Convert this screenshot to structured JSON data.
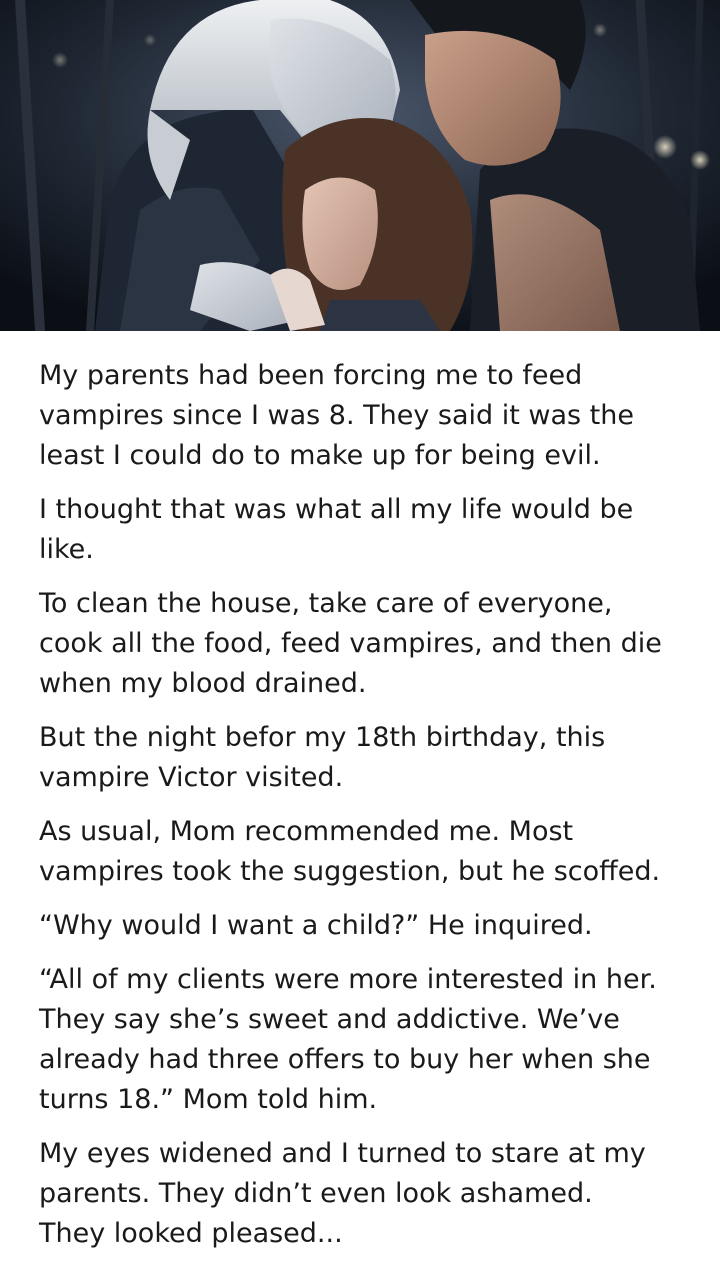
{
  "story": {
    "paragraphs": [
      [
        "My parents had been forcing me to feed",
        "vampires since I was 8. They said it was the",
        "least I could do to make up for being evil."
      ],
      [
        "I thought that was what all my life would be",
        "like."
      ],
      [
        "To clean the house, take care of everyone,",
        "cook all the food, feed vampires, and then die",
        "when my blood drained."
      ],
      [
        "But the night befor my 18th birthday, this",
        "vampire Victor visited."
      ],
      [
        "As usual, Mom recommended me. Most",
        "vampires took the suggestion, but he scoffed."
      ],
      [
        "“Why would I want a child?” He inquired."
      ],
      [
        "“All of my clients were more interested in her.",
        "They say she’s sweet and addictive. We’ve",
        "already had three offers to buy her when she",
        "turns 18.” Mom told him."
      ],
      [
        "My eyes widened and I turned to stare at my",
        "parents. They didn’t even look ashamed.",
        "They looked pleased..."
      ]
    ]
  }
}
